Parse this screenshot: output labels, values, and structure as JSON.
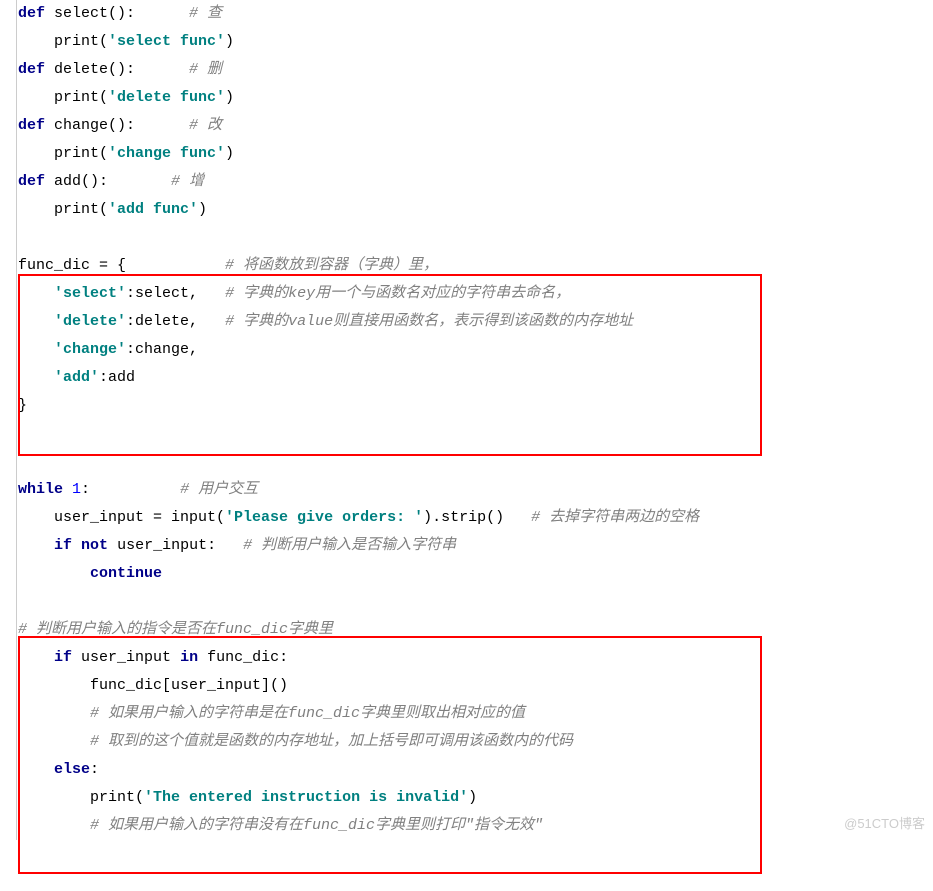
{
  "lines": {
    "l1_def": "def",
    "l1_name": " select():      ",
    "l1_cmt": "# 查",
    "l2_pr": "    print(",
    "l2_str": "'select func'",
    "l2_cl": ")",
    "l3_def": "def",
    "l3_name": " delete():      ",
    "l3_cmt": "# 删",
    "l4_pr": "    print(",
    "l4_str": "'delete func'",
    "l4_cl": ")",
    "l5_def": "def",
    "l5_name": " change():      ",
    "l5_cmt": "# 改",
    "l6_pr": "    print(",
    "l6_str": "'change func'",
    "l6_cl": ")",
    "l7_def": "def",
    "l7_name": " add():       ",
    "l7_cmt": "# 增",
    "l8_pr": "    print(",
    "l8_str": "'add func'",
    "l8_cl": ")",
    "l9_blank": " ",
    "l10_a": "func_dic = {           ",
    "l10_cmt": "# 将函数放到容器（字典）里，",
    "l11_a": "    ",
    "l11_key": "'select'",
    "l11_b": ":select,   ",
    "l11_cmt": "# 字典的key用一个与函数名对应的字符串去命名，",
    "l12_a": "    ",
    "l12_key": "'delete'",
    "l12_b": ":delete,   ",
    "l12_cmt": "# 字典的value则直接用函数名，表示得到该函数的内存地址",
    "l13_a": "    ",
    "l13_key": "'change'",
    "l13_b": ":change,",
    "l14_a": "    ",
    "l14_key": "'add'",
    "l14_b": ":add",
    "l15_a": "}",
    "l16_blank": " ",
    "l17_while": "while",
    "l17_b": " ",
    "l17_num": "1",
    "l17_c": ":          ",
    "l17_cmt": "# 用户交互",
    "l18_a": "    user_input = input(",
    "l18_str": "'Please give orders: '",
    "l18_b": ").strip()   ",
    "l18_cmt": "# 去掉字符串两边的空格",
    "l19_a": "    ",
    "l19_if": "if",
    "l19_b": " ",
    "l19_not": "not",
    "l19_c": " user_input:   ",
    "l19_cmt": "# 判断用户输入是否输入字符串",
    "l20_a": "        ",
    "l20_cont": "continue",
    "l21_blank": " ",
    "l22_cmt": "# 判断用户输入的指令是否在func_dic字典里",
    "l23_a": "    ",
    "l23_if": "if",
    "l23_b": " user_input ",
    "l23_in": "in",
    "l23_c": " func_dic:",
    "l24_a": "        func_dic[user_input]()",
    "l25_a": "        ",
    "l25_cmt": "# 如果用户输入的字符串是在func_dic字典里则取出相对应的值",
    "l26_a": "        ",
    "l26_cmt": "# 取到的这个值就是函数的内存地址，加上括号即可调用该函数内的代码",
    "l27_a": "    ",
    "l27_else": "else",
    "l27_b": ":",
    "l28_a": "        print(",
    "l28_str": "'The entered instruction is invalid'",
    "l28_b": ")",
    "l29_a": "        ",
    "l29_cmt": "# 如果用户输入的字符串没有在func_dic字典里则打印\"指令无效\""
  },
  "watermark": "@51CTO博客"
}
